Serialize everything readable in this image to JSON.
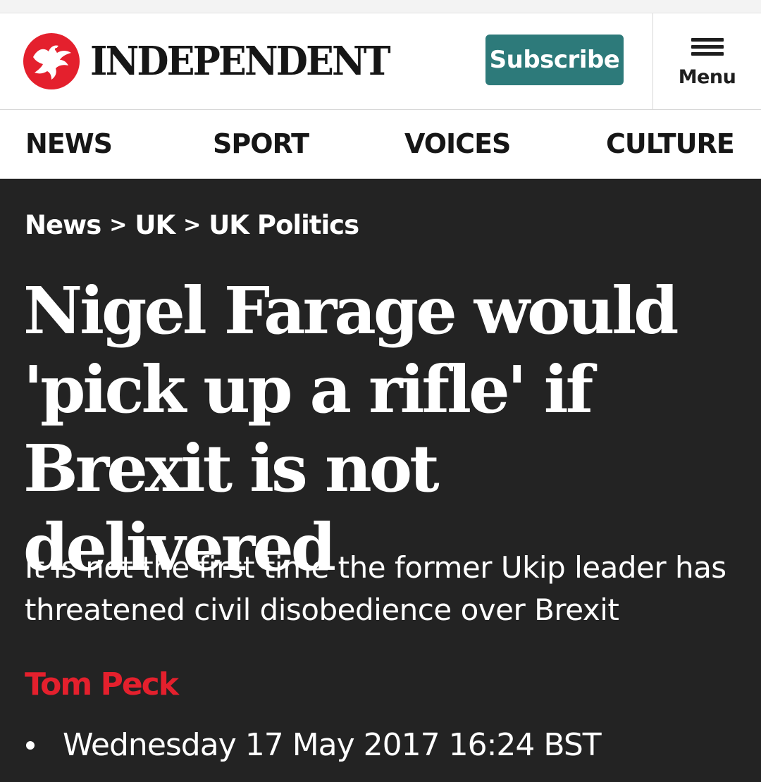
{
  "header": {
    "brand": "INDEPENDENT",
    "logo_icon": "eagle-icon",
    "logo_color": "#e4202d",
    "subscribe_label": "Subscribe",
    "subscribe_color": "#2d7a7a",
    "menu_label": "Menu",
    "menu_icon": "hamburger-icon"
  },
  "nav": {
    "items": [
      {
        "label": "NEWS"
      },
      {
        "label": "SPORT"
      },
      {
        "label": "VOICES"
      },
      {
        "label": "CULTURE"
      }
    ]
  },
  "article": {
    "breadcrumb": [
      {
        "label": "News"
      },
      {
        "label": "UK"
      },
      {
        "label": "UK Politics"
      }
    ],
    "breadcrumb_separator": ">",
    "headline": "Nigel Farage would 'pick up a rifle' if Brexit is not delivered",
    "standfirst": "It is not the first time the former Ukip leader has threatened civil disobedience over Brexit",
    "author": "Tom Peck",
    "author_color": "#e4202d",
    "date": "Wednesday 17 May 2017 16:24 BST"
  },
  "colors": {
    "page_background": "#232323"
  }
}
